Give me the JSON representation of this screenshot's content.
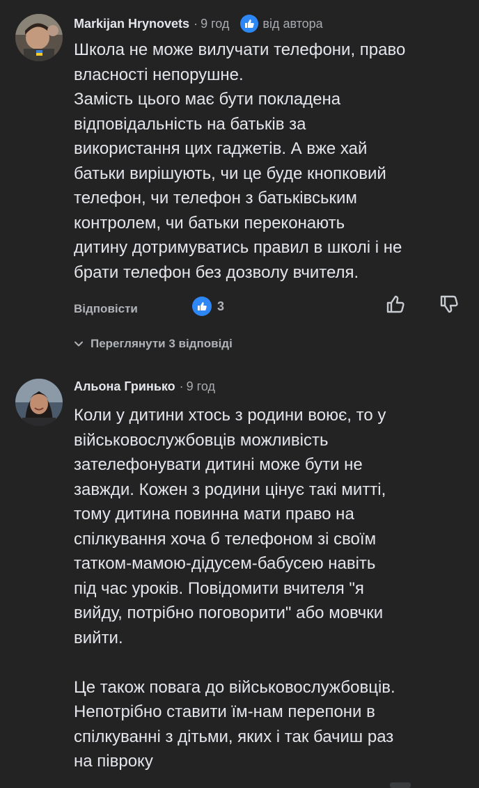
{
  "comments": [
    {
      "author": "Markijan Hrynovets",
      "time": "9 год",
      "author_badge_label": "від автора",
      "text": "Школа не може вилучати телефони, право\nвласності непорушне.\nЗамість цього має бути покладена\nвідповідальність на батьків за\nвикористання цих гаджетів. А вже хай\nбатьки вирішують, чи це буде кнопковий\nтелефон, чи телефон з батьківським\nконтролем, чи батьки переконають\nдитину дотримуватись правил в школі і не\nбрати телефон без дозволу вчителя.",
      "reply_label": "Відповісти",
      "reaction_count": "3",
      "view_replies_label": "Переглянути 3 відповіді"
    },
    {
      "author": "Альона Гринько",
      "time": "9 год",
      "text": "Коли у дитини хтось з родини воює, то у\nвійськовослужбовців можливість\nзателефонувати дитині може бути не\nзавжди. Кожен з родини цінує такі митті,\nтому дитина повинна мати право на\nспілкування хоча б телефоном зі своїм\nтатком-мамою-дідусем-бабусею навіть\nпід час уроків. Повідомити вчителя \"я\nвийду, потрібно поговорити\" або мовчки\nвийти.\n\nЦе також повага до військовослужбовців.\nНепотрібно ставити їм-нам перепони в\nспілкуванні з дітьми, яких і так бачиш раз\nна півроку"
    }
  ],
  "icons": {
    "like_badge": "thumbs-up-icon",
    "like": "thumbs-up-outline-icon",
    "dislike": "thumbs-down-outline-icon",
    "expand": "chevron-down-icon"
  },
  "colors": {
    "background": "#232324",
    "text": "#e4e6eb",
    "muted": "#a8abaf",
    "accent": "#2d87f5"
  }
}
